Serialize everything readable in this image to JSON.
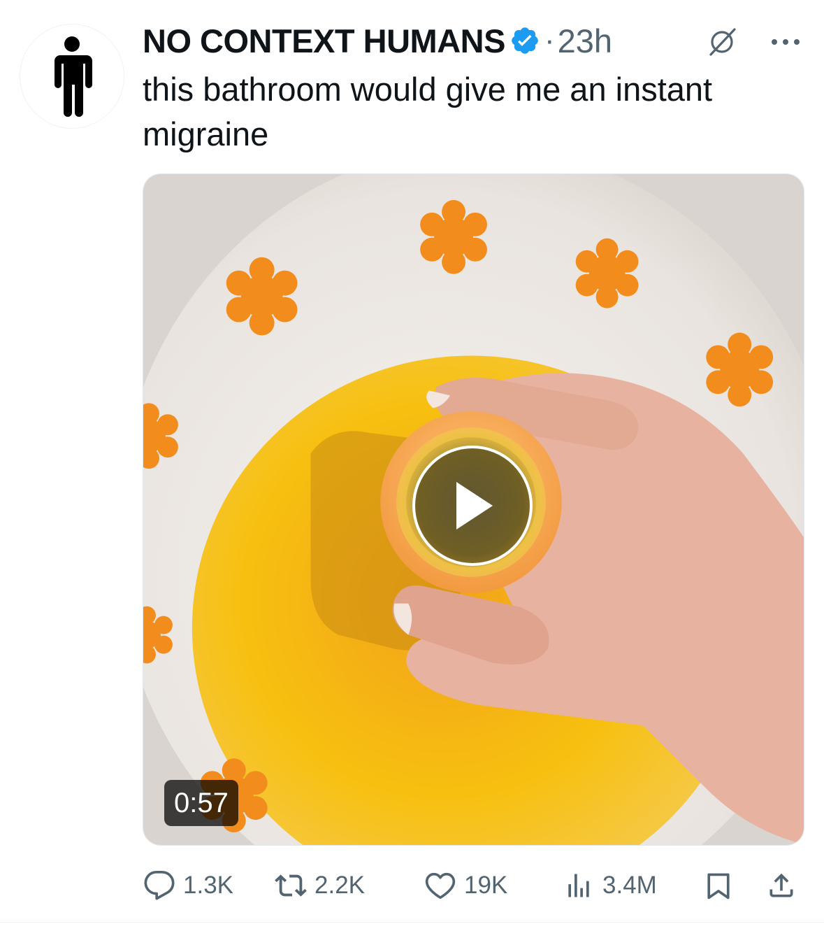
{
  "tweet": {
    "author_name": "NO CONTEXT HUMANS",
    "separator": "·",
    "timestamp": "23h",
    "text": "this bathroom would give me an instant migraine",
    "video_duration": "0:57"
  },
  "actions": {
    "replies": "1.3K",
    "reposts": "2.2K",
    "likes": "19K",
    "views": "3.4M"
  },
  "colors": {
    "verified_badge": "#1d9bf0",
    "secondary_text": "#536471",
    "primary_text": "#0f1419"
  },
  "icons": [
    "person-avatar-icon",
    "verified-badge-icon",
    "grok-icon",
    "more-icon",
    "play-icon",
    "reply-icon",
    "repost-icon",
    "like-icon",
    "views-icon",
    "bookmark-icon",
    "share-icon"
  ]
}
